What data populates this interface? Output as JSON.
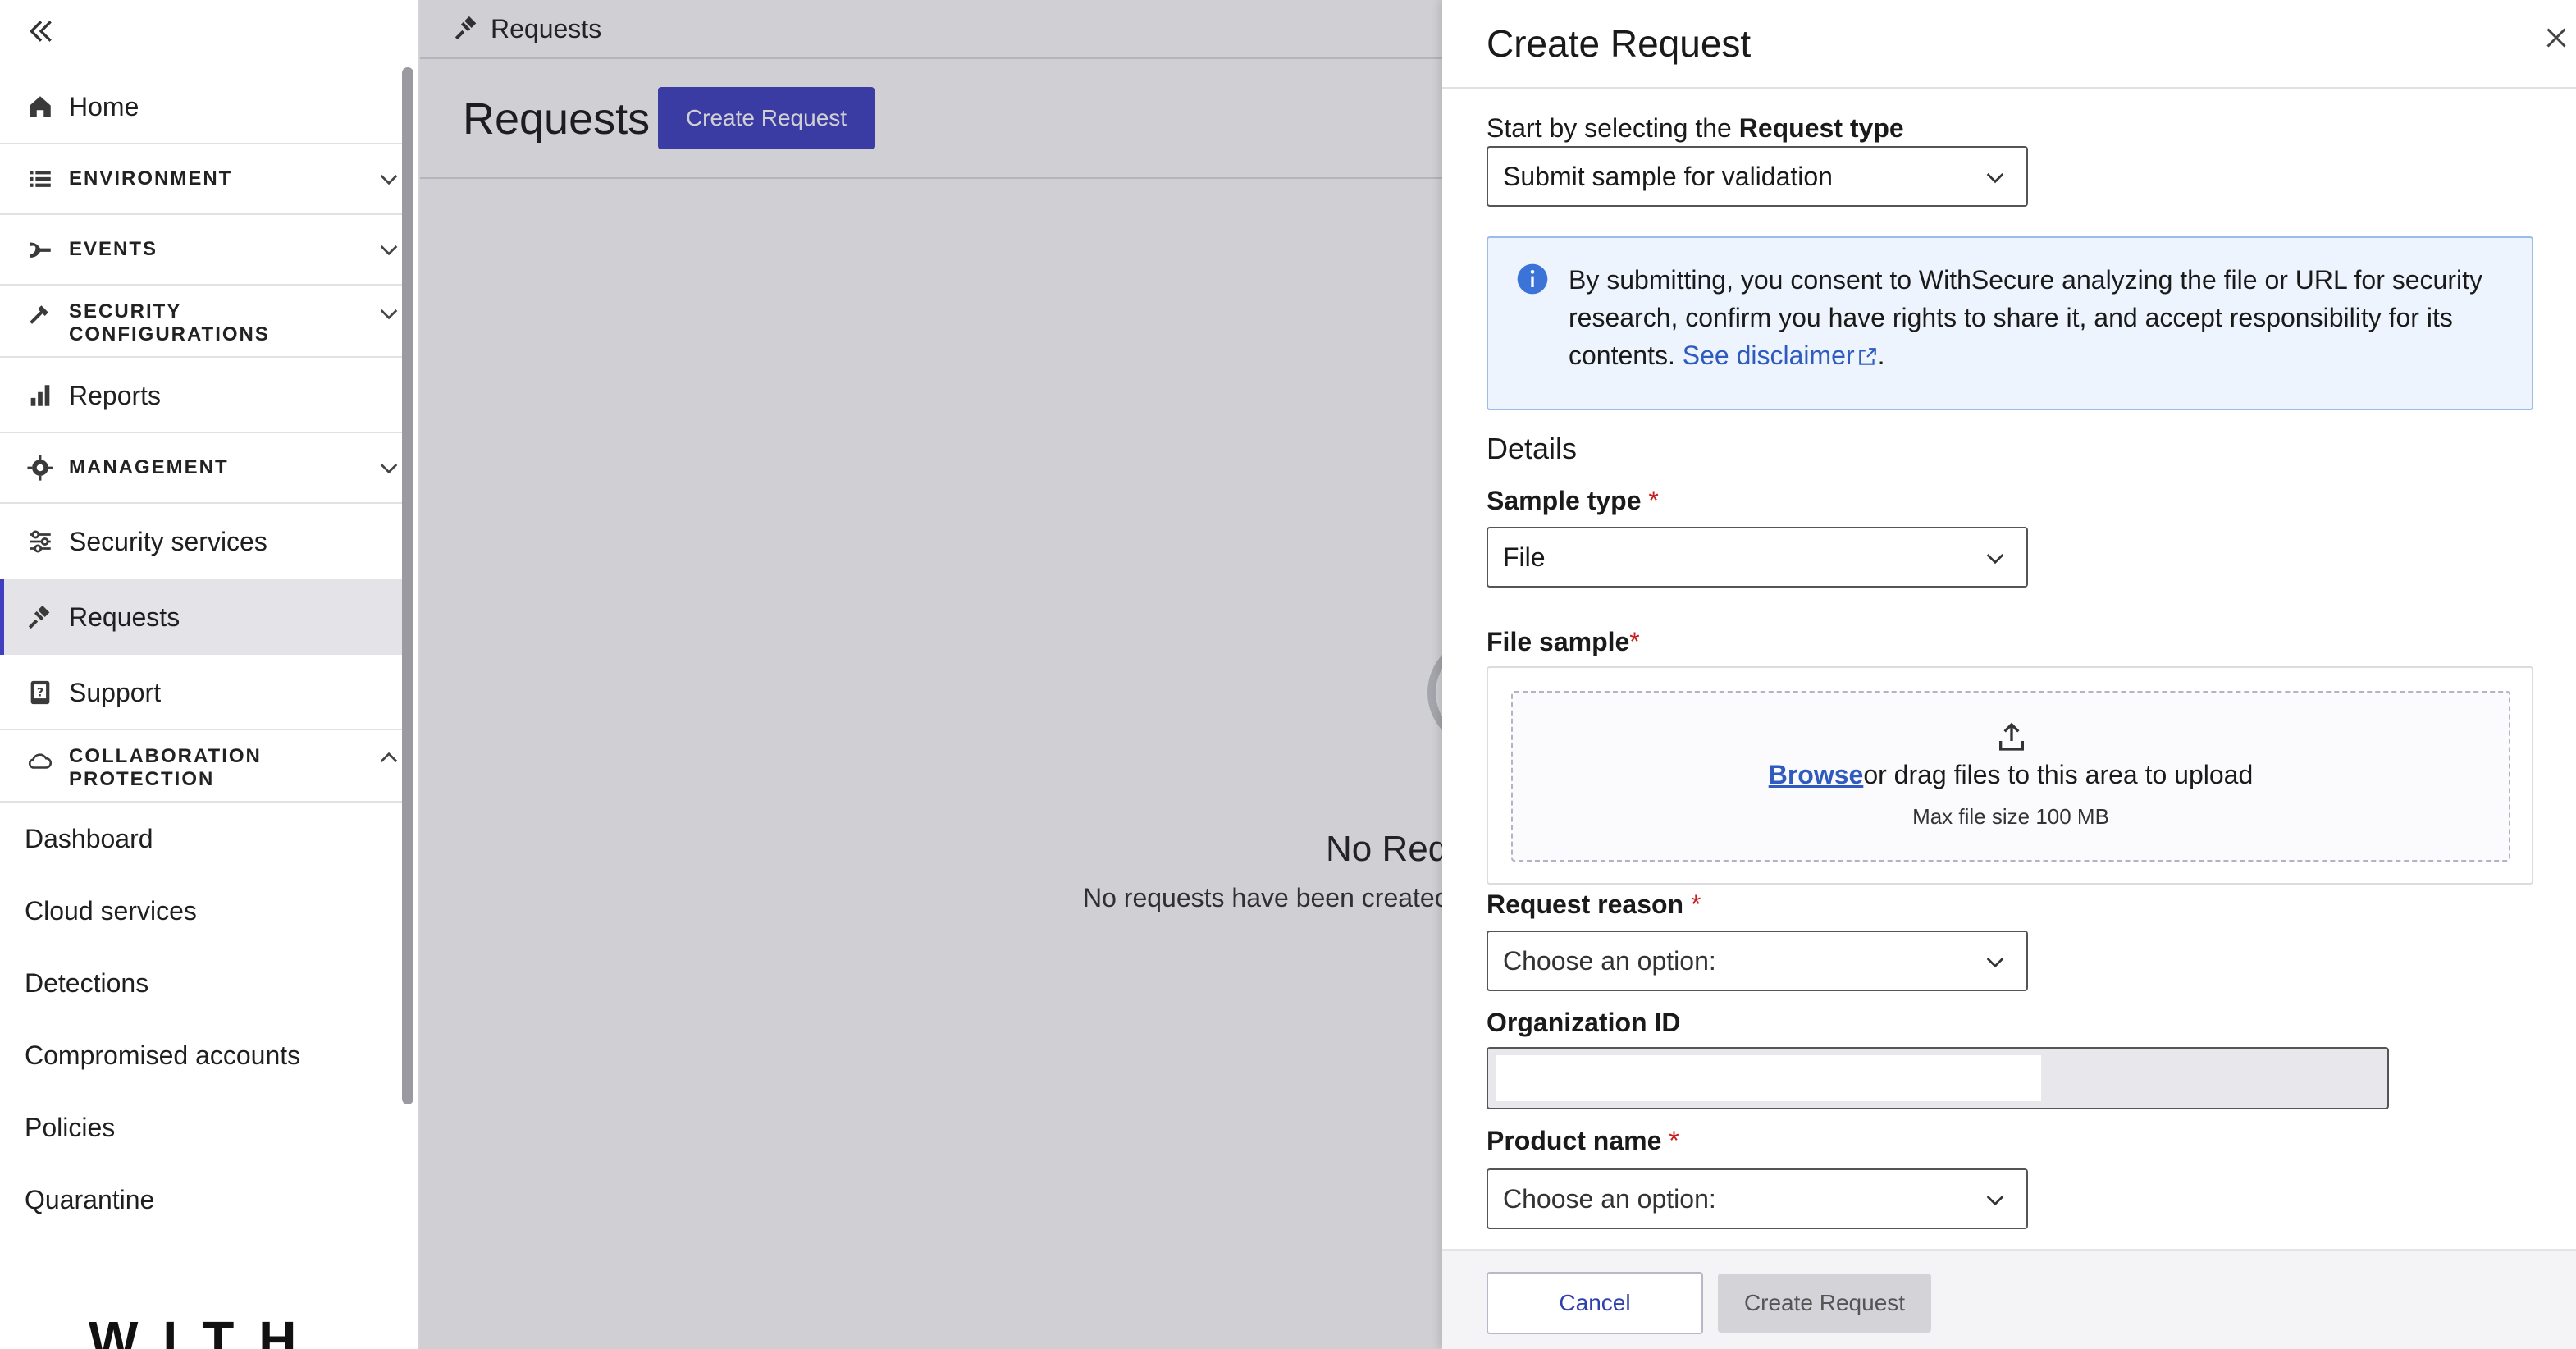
{
  "sidebar": {
    "items": {
      "home": "Home",
      "environment": "ENVIRONMENT",
      "events": "EVENTS",
      "security_configurations": "SECURITY CONFIGURATIONS",
      "reports": "Reports",
      "management": "MANAGEMENT",
      "security_services": "Security services",
      "requests": "Requests",
      "support": "Support",
      "collaboration_protection": "COLLABORATION PROTECTION"
    },
    "sub_items": [
      "Dashboard",
      "Cloud services",
      "Detections",
      "Compromised accounts",
      "Policies",
      "Quarantine"
    ],
    "logo_text": "WITH"
  },
  "topbar": {
    "breadcrumb": "Requests"
  },
  "page": {
    "title": "Requests",
    "create_button": "Create Request",
    "empty_title": "No Req",
    "empty_subtitle": "No requests have been createc"
  },
  "drawer": {
    "title": "Create Request",
    "request_type": {
      "label_prefix": "Start by selecting the ",
      "label_bold": "Request type",
      "value": "Submit sample for validation"
    },
    "info": {
      "text": "By submitting, you consent to WithSecure analyzing the file or URL for security research, confirm you have rights to share it, and accept responsibility for its contents. ",
      "link": "See disclaimer",
      "suffix": "."
    },
    "details_title": "Details",
    "sample_type": {
      "label": "Sample type",
      "required_mark": "*",
      "value": "File"
    },
    "file_sample": {
      "label": "File sample",
      "required_mark": "*",
      "browse": "Browse",
      "drag_text": "or drag files to this area to upload",
      "max_size": "Max file size 100 MB"
    },
    "request_reason": {
      "label": "Request reason",
      "required_mark": "*",
      "value": "Choose an option:"
    },
    "organization_id": {
      "label": "Organization ID",
      "value": ""
    },
    "product_name": {
      "label": "Product name",
      "required_mark": "*",
      "value": "Choose an option:"
    },
    "footer": {
      "cancel": "Cancel",
      "create": "Create Request"
    }
  },
  "colors": {
    "accent": "#3f40c0",
    "link": "#2f5bbf",
    "required": "#c81e1e",
    "info_bg": "#eef4fd"
  }
}
